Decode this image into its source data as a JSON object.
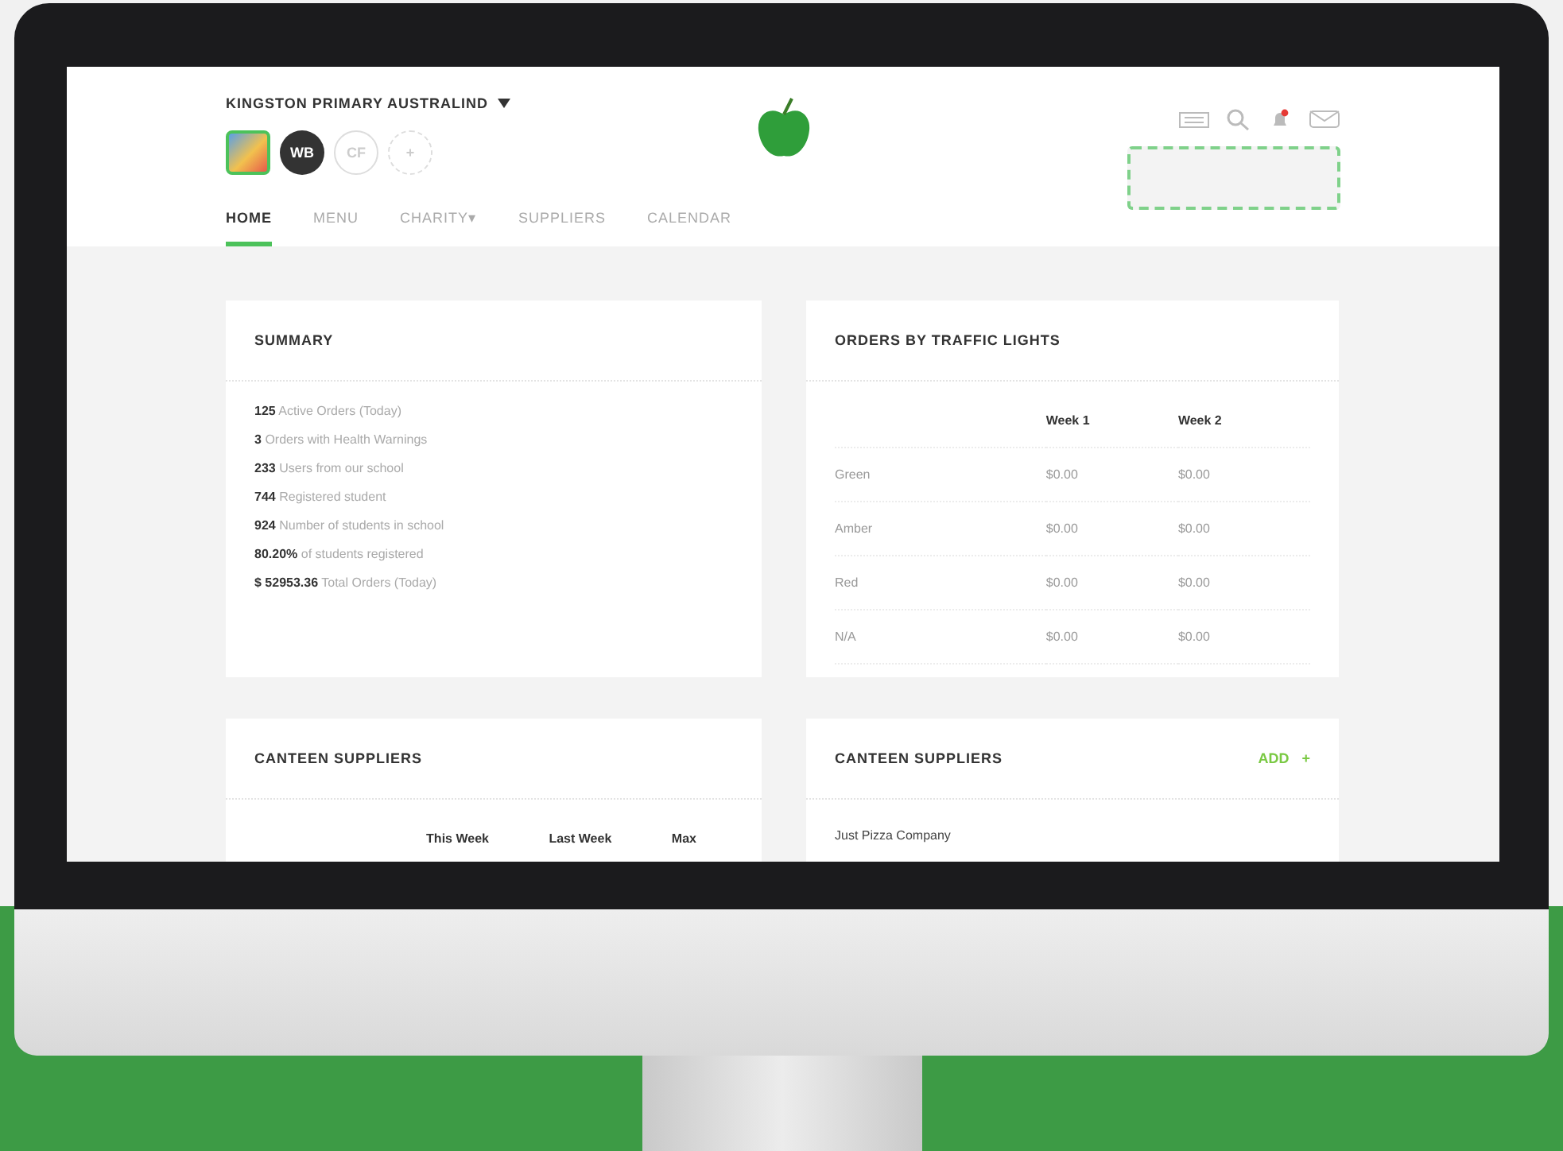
{
  "header": {
    "school": "KINGSTON PRIMARY AUSTRALIND",
    "avatars": [
      {
        "kind": "image",
        "selected": true
      },
      {
        "kind": "initials",
        "text": "WB",
        "selected": false
      },
      {
        "kind": "outline",
        "text": "CF",
        "selected": false
      },
      {
        "kind": "add",
        "text": "+",
        "selected": false
      }
    ]
  },
  "tabs": [
    {
      "label": "HOME",
      "selected": true
    },
    {
      "label": "MENU",
      "selected": false
    },
    {
      "label": "CHARITY",
      "dropdown_icon": "▾",
      "selected": false
    },
    {
      "label": "SUPPLIERS",
      "selected": false
    },
    {
      "label": "CALENDAR",
      "selected": false
    }
  ],
  "summary": {
    "title": "SUMMARY",
    "items": [
      {
        "value": "125",
        "label": "Active Orders (Today)"
      },
      {
        "value": "3",
        "label": "Orders with Health Warnings"
      },
      {
        "value": "233",
        "label": "Users from our school"
      },
      {
        "value": "744",
        "label": "Registered student"
      },
      {
        "value": "924",
        "label": "Number of students in school"
      },
      {
        "value": "80.20%",
        "label": "of students registered"
      },
      {
        "value": "$ 52953.36",
        "label": "Total Orders (Today)"
      }
    ]
  },
  "traffic": {
    "title": "ORDERS BY TRAFFIC LIGHTS",
    "columns": [
      "Week 1",
      "Week 2"
    ],
    "rows": [
      {
        "label": "Green",
        "values": [
          "$0.00",
          "$0.00"
        ]
      },
      {
        "label": "Amber",
        "values": [
          "$0.00",
          "$0.00"
        ]
      },
      {
        "label": "Red",
        "values": [
          "$0.00",
          "$0.00"
        ]
      },
      {
        "label": "N/A",
        "values": [
          "$0.00",
          "$0.00"
        ]
      }
    ]
  },
  "suppliers_stats": {
    "title": "CANTEEN SUPPLIERS",
    "columns": [
      "This Week",
      "Last Week",
      "Max"
    ]
  },
  "suppliers_list": {
    "title": "CANTEEN SUPPLIERS",
    "add": "ADD",
    "add_icon": "+",
    "items": [
      "Just Pizza Company"
    ]
  }
}
